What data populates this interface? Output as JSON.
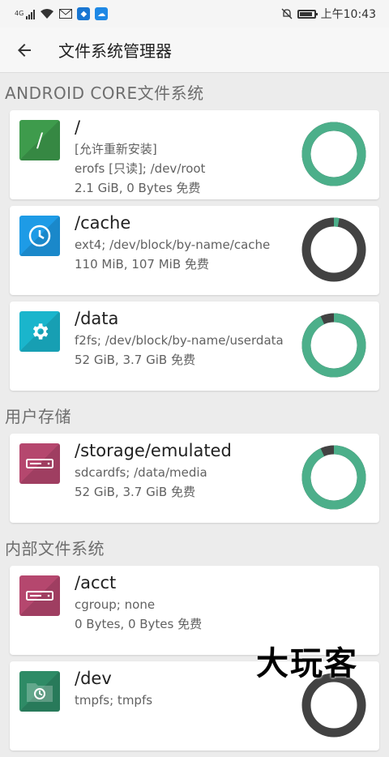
{
  "status_bar": {
    "network": "4G",
    "time": "上午10:43",
    "icons": [
      "signal-icon",
      "wifi-icon",
      "mail-icon",
      "shield-icon",
      "cloud-icon",
      "mute-icon",
      "battery-icon"
    ]
  },
  "app_bar": {
    "back_icon": "arrow-left-icon",
    "title": "文件系统管理器"
  },
  "sections": [
    {
      "header": "ANDROID CORE文件系统",
      "items": [
        {
          "mount": "/",
          "lines": [
            "[允许重新安装]",
            "erofs [只读]; /dev/root",
            "2.1 GiB, 0 Bytes 免费"
          ],
          "icon": "slash-icon",
          "tile_color": "#3e9b4c",
          "used_fraction": 1.0,
          "used_color": "#4caf8a"
        },
        {
          "mount": "/cache",
          "lines": [
            "ext4; /dev/block/by-name/cache",
            "110 MiB, 107 MiB 免费"
          ],
          "icon": "clock-icon",
          "tile_color": "#1e9be6",
          "used_fraction": 0.027,
          "used_color": "#4caf8a"
        },
        {
          "mount": "/data",
          "lines": [
            "f2fs; /dev/block/by-name/userdata",
            "52 GiB, 3.7 GiB 免费"
          ],
          "icon": "gear-icon",
          "tile_color": "#1ab5cc",
          "used_fraction": 0.93,
          "used_color": "#4caf8a"
        }
      ]
    },
    {
      "header": "用户存储",
      "items": [
        {
          "mount": "/storage/emulated",
          "lines": [
            "sdcardfs; /data/media",
            "52 GiB, 3.7 GiB 免费"
          ],
          "icon": "drive-icon",
          "tile_color": "#b5476e",
          "used_fraction": 0.93,
          "used_color": "#4caf8a"
        }
      ]
    },
    {
      "header": "内部文件系统",
      "items": [
        {
          "mount": "/acct",
          "lines": [
            "cgroup; none",
            "0 Bytes, 0 Bytes 免费"
          ],
          "icon": "drive-icon",
          "tile_color": "#b5476e",
          "used_fraction": null,
          "used_color": "#4caf8a"
        },
        {
          "mount": "/dev",
          "lines": [
            "tmpfs; tmpfs"
          ],
          "icon": "folder-clock-icon",
          "tile_color": "#2e8b66",
          "used_fraction": 0.0,
          "used_color": "#4caf8a"
        }
      ]
    }
  ],
  "colors": {
    "ring_free": "#424242",
    "ring_used": "#4caf8a"
  },
  "watermark": "大玩客"
}
